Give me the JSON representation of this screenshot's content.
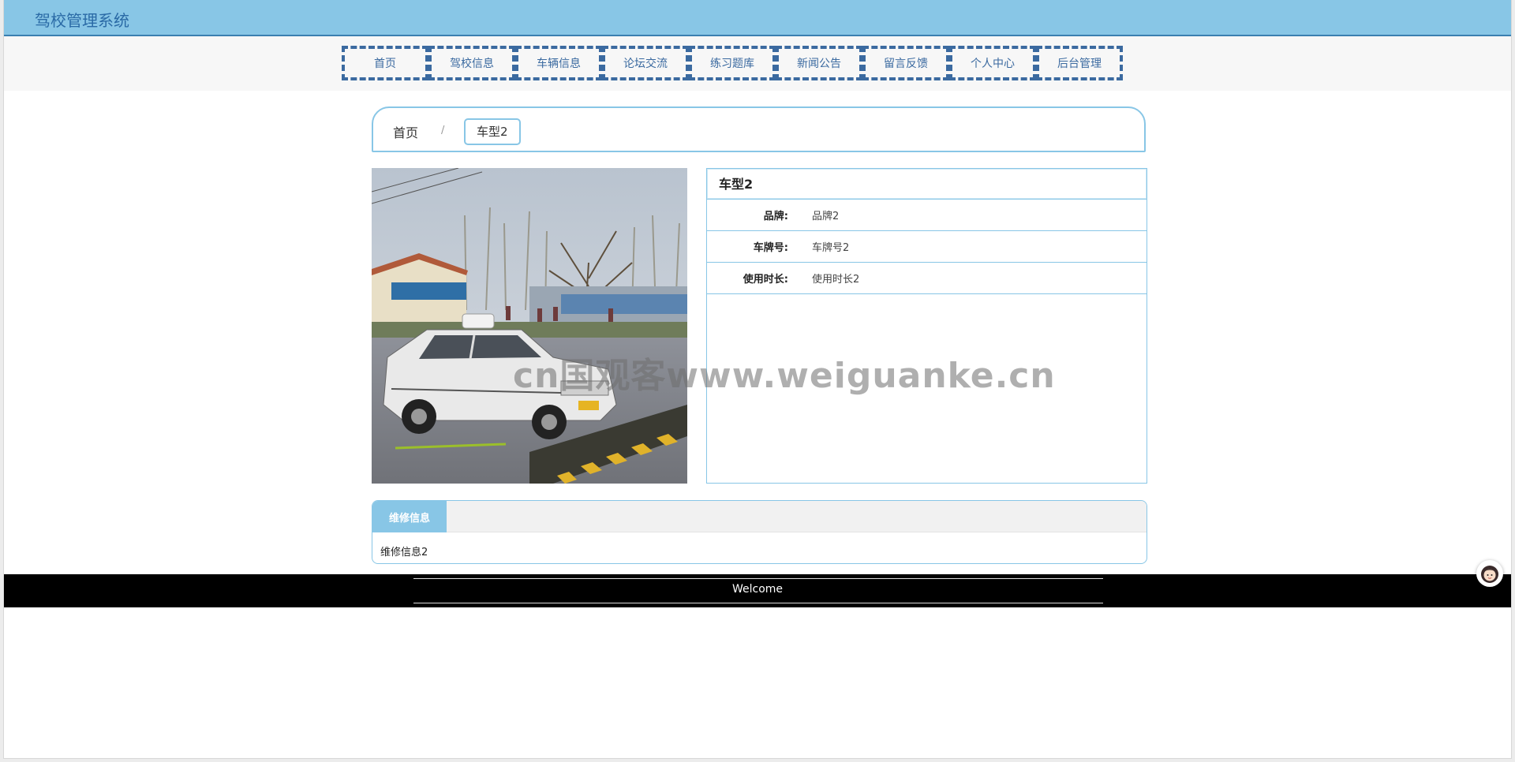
{
  "header": {
    "title": "驾校管理系统"
  },
  "nav": {
    "items": [
      {
        "label": "首页"
      },
      {
        "label": "驾校信息"
      },
      {
        "label": "车辆信息"
      },
      {
        "label": "论坛交流"
      },
      {
        "label": "练习题库"
      },
      {
        "label": "新闻公告"
      },
      {
        "label": "留言反馈"
      },
      {
        "label": "个人中心"
      },
      {
        "label": "后台管理"
      }
    ]
  },
  "breadcrumb": {
    "home": "首页",
    "separator": "/",
    "current": "车型2"
  },
  "vehicle": {
    "name": "车型2",
    "fields": [
      {
        "label": "品牌:",
        "value": "品牌2"
      },
      {
        "label": "车牌号:",
        "value": "车牌号2"
      },
      {
        "label": "使用时长:",
        "value": "使用时长2"
      }
    ]
  },
  "repair": {
    "tab_label": "维修信息",
    "content": "维修信息2"
  },
  "footer": {
    "text": "Welcome"
  },
  "watermark": {
    "text": "cn国观客www.weiguanke.cn"
  },
  "colors": {
    "header_bg": "#88c6e6",
    "accent": "#3b6aa0",
    "footer_bg": "#000000"
  }
}
